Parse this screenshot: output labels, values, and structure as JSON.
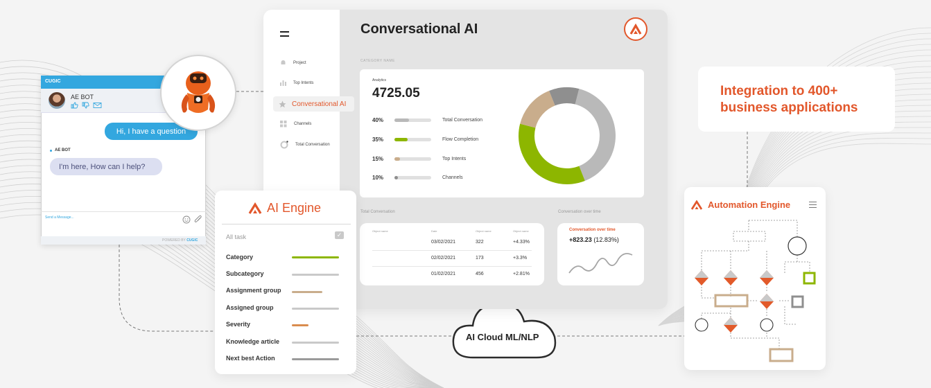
{
  "dashboard": {
    "title": "Conversational AI",
    "sidebar": [
      {
        "label": "Project",
        "icon": "bell-icon"
      },
      {
        "label": "Top Intents",
        "icon": "bar-chart-icon"
      },
      {
        "label": "Conversational AI",
        "icon": "star-icon",
        "active": true
      },
      {
        "label": "Channels",
        "icon": "grid-icon"
      },
      {
        "label": "Total Conversation",
        "icon": "chat-icon"
      }
    ],
    "category_name": "CATEGORY NAME",
    "analytics": {
      "label": "Analytics",
      "value": "4725.05",
      "stats": [
        {
          "pct": "40%",
          "label": "Total Conversation",
          "fill": 0.4,
          "color": "#b9b9b9"
        },
        {
          "pct": "35%",
          "label": "Flow Completion",
          "fill": 0.35,
          "color": "#8db600"
        },
        {
          "pct": "15%",
          "label": "Top Intents",
          "fill": 0.15,
          "color": "#c9ad8c"
        },
        {
          "pct": "10%",
          "label": "Channels",
          "fill": 0.1,
          "color": "#8f8f8f"
        }
      ]
    },
    "total_conversation": {
      "label": "Total Conversation",
      "headers": [
        "Object name",
        "Date",
        "Object name",
        "Object name"
      ],
      "rows": [
        {
          "date": "03/02/2021",
          "count": "322",
          "change": "+4.33%"
        },
        {
          "date": "02/02/2021",
          "count": "173",
          "change": "+3.3%"
        },
        {
          "date": "01/02/2021",
          "count": "456",
          "change": "+2.81%"
        }
      ]
    },
    "conversation_over_time": {
      "label": "Conversation over time",
      "card_title": "Conversation over time",
      "value": "+823.23",
      "pct": "(12.83%)"
    }
  },
  "chat": {
    "brand": "CUGIC",
    "bot_name": "AE BOT",
    "user_message": "Hi, I have a question",
    "bot_label": "AE BOT",
    "bot_message": "I'm here, How can I help?",
    "input_placeholder": "Send a Message...",
    "powered_prefix": "POWERED BY",
    "powered_brand": "CUGIC"
  },
  "ai_engine": {
    "title": "AI Engine",
    "all_task": "All task",
    "items": [
      {
        "label": "Category",
        "color": "#8db600",
        "width": 0.85
      },
      {
        "label": "Subcategory",
        "color": "#c9c9c9",
        "width": 0.85
      },
      {
        "label": "Assignment group",
        "color": "#c9ad8c",
        "width": 0.55
      },
      {
        "label": "Assigned group",
        "color": "#c9c9c9",
        "width": 0.85
      },
      {
        "label": "Severity",
        "color": "#d98c4e",
        "width": 0.3
      },
      {
        "label": "Knowledge article",
        "color": "#c9c9c9",
        "width": 0.85
      },
      {
        "label": "Next best Action",
        "color": "#9a9a9a",
        "width": 0.85
      }
    ]
  },
  "cloud": {
    "label": "AI Cloud ML/NLP"
  },
  "integration": {
    "line1": "Integration to 400+",
    "line2": "business applications"
  },
  "automation": {
    "title": "Automation Engine"
  },
  "colors": {
    "accent": "#e2572b",
    "green": "#8db600",
    "tan": "#c9ad8c",
    "gray": "#b9b9b9",
    "dark_gray": "#8f8f8f",
    "chat_blue": "#33a7df"
  },
  "chart_data": {
    "type": "pie",
    "style": "donut",
    "categories": [
      "Total Conversation",
      "Flow Completion",
      "Top Intents",
      "Channels"
    ],
    "values": [
      40,
      35,
      15,
      10
    ],
    "colors": [
      "#b9b9b9",
      "#8db600",
      "#c9ad8c",
      "#8f8f8f"
    ]
  }
}
